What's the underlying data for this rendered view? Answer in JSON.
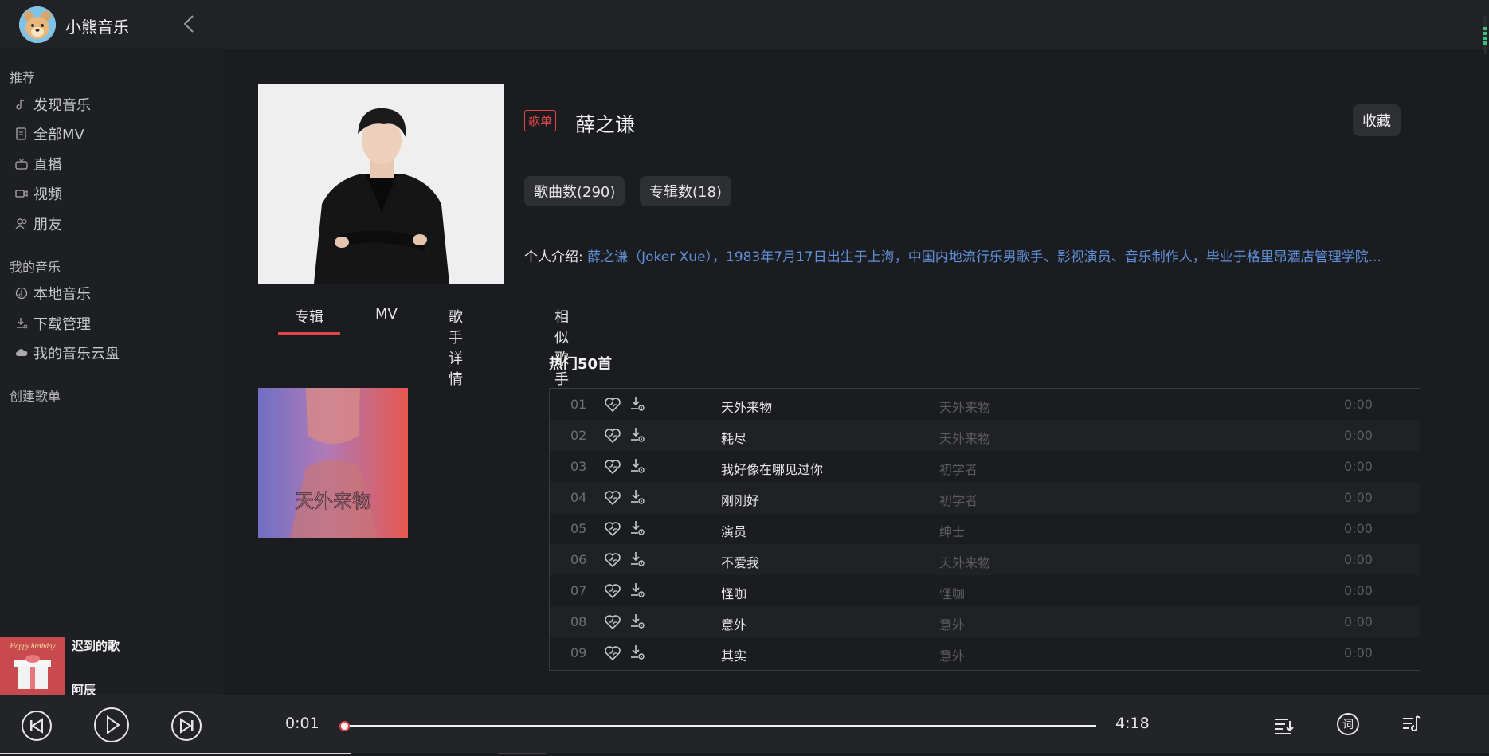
{
  "app": {
    "title": "小熊音乐"
  },
  "sidebar": {
    "sections": [
      {
        "heading": "推荐",
        "items": [
          {
            "label": "发现音乐",
            "icon": "music-note-icon"
          },
          {
            "label": "全部MV",
            "icon": "document-icon"
          },
          {
            "label": "直播",
            "icon": "tv-icon"
          },
          {
            "label": "视频",
            "icon": "video-camera-icon"
          },
          {
            "label": "朋友",
            "icon": "friends-icon"
          }
        ]
      },
      {
        "heading": "我的音乐",
        "items": [
          {
            "label": "本地音乐",
            "icon": "music-disc-icon"
          },
          {
            "label": "下载管理",
            "icon": "download-icon"
          },
          {
            "label": "我的音乐云盘",
            "icon": "cloud-icon"
          }
        ]
      },
      {
        "heading": "创建歌单",
        "items": []
      }
    ]
  },
  "now_playing": {
    "title": "迟到的歌",
    "artist": "阿辰",
    "cover_text": "Happy birthday"
  },
  "artist": {
    "tag": "歌单",
    "name": "薛之谦",
    "favorite_label": "收藏",
    "song_count_label": "歌曲数(290)",
    "album_count_label": "专辑数(18)",
    "intro_label": "个人介绍:",
    "intro_text": "薛之谦（Joker Xue），1983年7月17日出生于上海，中国内地流行乐男歌手、影视演员、音乐制作人，毕业于格里昂酒店管理学院..."
  },
  "tabs": [
    {
      "label": "专辑",
      "active": true
    },
    {
      "label": "MV",
      "active": false
    },
    {
      "label": "歌手详情",
      "active": false
    },
    {
      "label": "相似歌手",
      "active": false
    }
  ],
  "album_cover_text": "天外来物",
  "hot_songs": {
    "title": "热门50首",
    "rows": [
      {
        "index": "01",
        "name": "天外来物",
        "album": "天外来物",
        "duration": "0:00"
      },
      {
        "index": "02",
        "name": "耗尽",
        "album": "天外来物",
        "duration": "0:00"
      },
      {
        "index": "03",
        "name": "我好像在哪见过你",
        "album": "初学者",
        "duration": "0:00"
      },
      {
        "index": "04",
        "name": "刚刚好",
        "album": "初学者",
        "duration": "0:00"
      },
      {
        "index": "05",
        "name": "演员",
        "album": "绅士",
        "duration": "0:00"
      },
      {
        "index": "06",
        "name": "不爱我",
        "album": "天外来物",
        "duration": "0:00"
      },
      {
        "index": "07",
        "name": "怪咖",
        "album": "怪咖",
        "duration": "0:00"
      },
      {
        "index": "08",
        "name": "意外",
        "album": "意外",
        "duration": "0:00"
      },
      {
        "index": "09",
        "name": "其实",
        "album": "意外",
        "duration": "0:00"
      }
    ]
  },
  "player": {
    "current_time": "0:01",
    "total_time": "4:18",
    "progress": 0.004,
    "lyrics_label": "词"
  },
  "colors": {
    "accent": "#e0454a",
    "link": "#5f8fd6",
    "background": "#1b1c20"
  }
}
